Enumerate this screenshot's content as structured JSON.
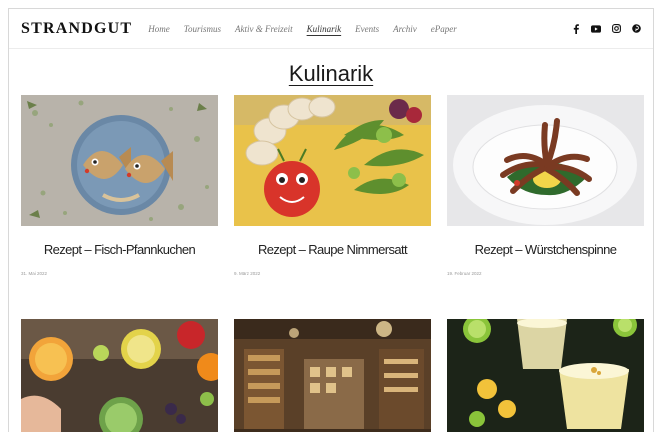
{
  "header": {
    "logo": "STRANDGUT",
    "nav": [
      "Home",
      "Tourismus",
      "Aktiv & Freizeit",
      "Kulinarik",
      "Events",
      "Archiv",
      "ePaper"
    ],
    "active_nav": "Kulinarik",
    "social_icons": [
      "facebook-icon",
      "youtube-icon",
      "instagram-icon",
      "pinterest-icon"
    ]
  },
  "page": {
    "title": "Kulinarik"
  },
  "articles": [
    {
      "title": "Rezept – Fisch-Pfannkuchen",
      "meta": "31. Mai 2022"
    },
    {
      "title": "Rezept – Raupe Nimmersatt",
      "meta": "9. März 2022"
    },
    {
      "title": "Rezept – Würstchenspinne",
      "meta": "19. Februar 2022"
    },
    {
      "title": "",
      "meta": ""
    },
    {
      "title": "",
      "meta": ""
    },
    {
      "title": "",
      "meta": ""
    }
  ],
  "colors": {
    "text": "#222222",
    "muted": "#777777",
    "border": "#d8d8d8",
    "background": "#ffffff"
  }
}
